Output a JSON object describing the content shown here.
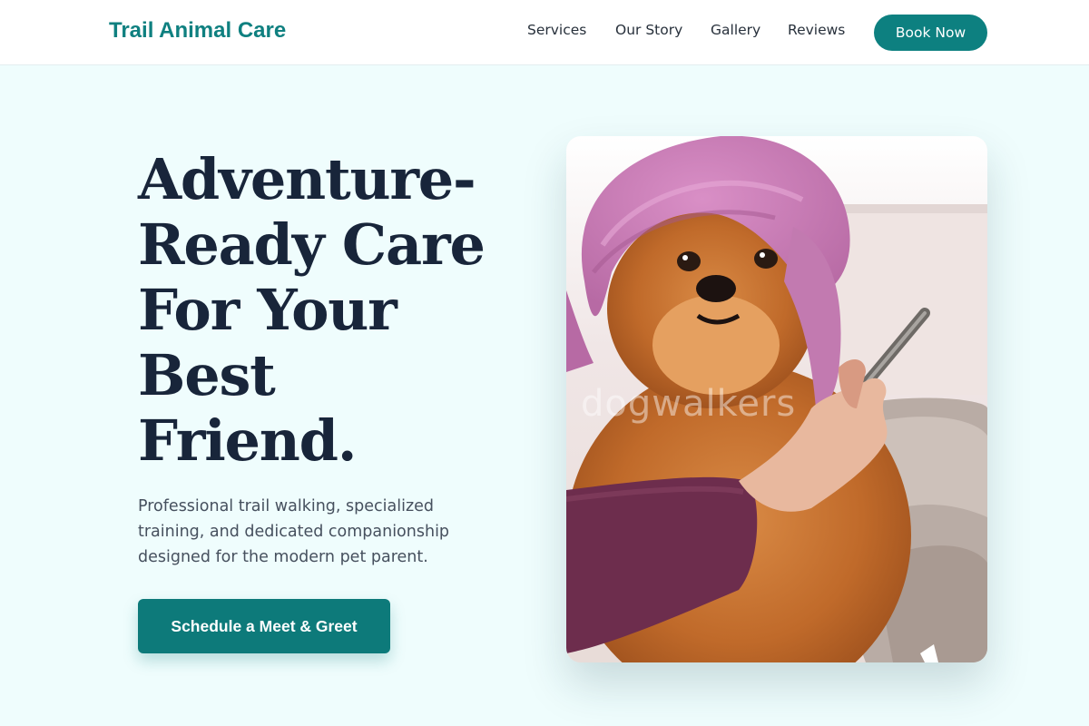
{
  "header": {
    "brand": "Trail Animal Care",
    "nav": [
      {
        "label": "Services"
      },
      {
        "label": "Our Story"
      },
      {
        "label": "Gallery"
      },
      {
        "label": "Reviews"
      }
    ],
    "cta_label": "Book Now"
  },
  "hero": {
    "title_lines": [
      "Adventure-",
      "Ready Care",
      "For Your",
      "Best",
      "Friend."
    ],
    "subtitle": "Professional trail walking, specialized training, and dedicated companionship designed for the modern pet parent.",
    "cta_label": "Schedule a Meet & Greet",
    "image": {
      "subject": "pomeranian-with-towel",
      "watermark": "dogwalkers"
    }
  },
  "colors": {
    "brand": "#0f8080",
    "button": "#0d7a7a",
    "page_background": "#effdfd",
    "heading": "#18253a"
  }
}
